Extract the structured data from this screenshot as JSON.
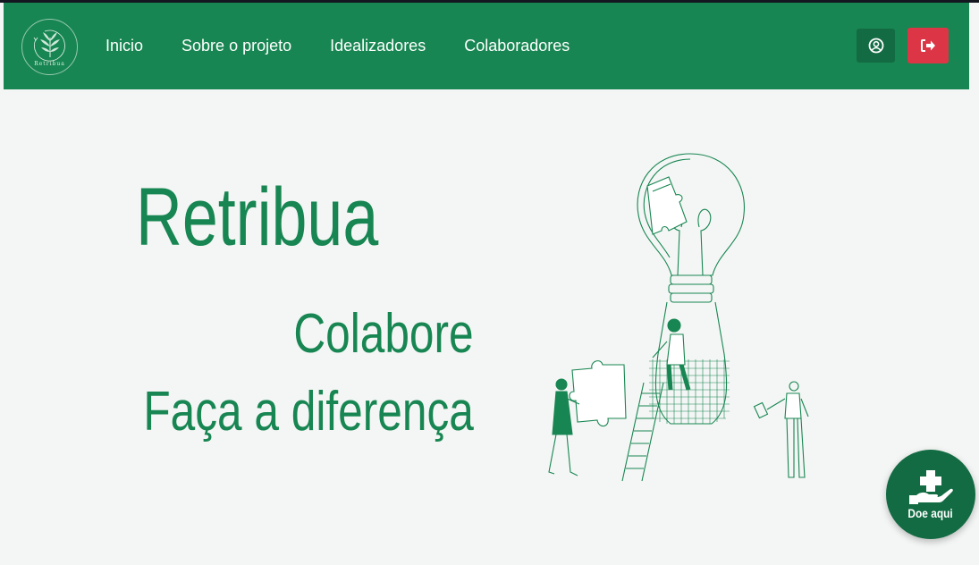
{
  "brand": {
    "logo_text": "Retribua"
  },
  "nav": {
    "items": [
      {
        "label": "Inicio"
      },
      {
        "label": "Sobre o projeto"
      },
      {
        "label": "Idealizadores"
      },
      {
        "label": "Colaboradores"
      }
    ],
    "user_icon": "user-circle-icon",
    "logout_icon": "sign-out-icon"
  },
  "hero": {
    "title": "Retribua",
    "line1": "Colabore",
    "line2": "Faça a diferença"
  },
  "donate": {
    "label": "Doe aqui",
    "icon": "hand-holding-medical-icon"
  },
  "colors": {
    "primary": "#188652",
    "primary_dark": "#126b42",
    "danger": "#dc3545",
    "background": "#f4f6f5"
  }
}
